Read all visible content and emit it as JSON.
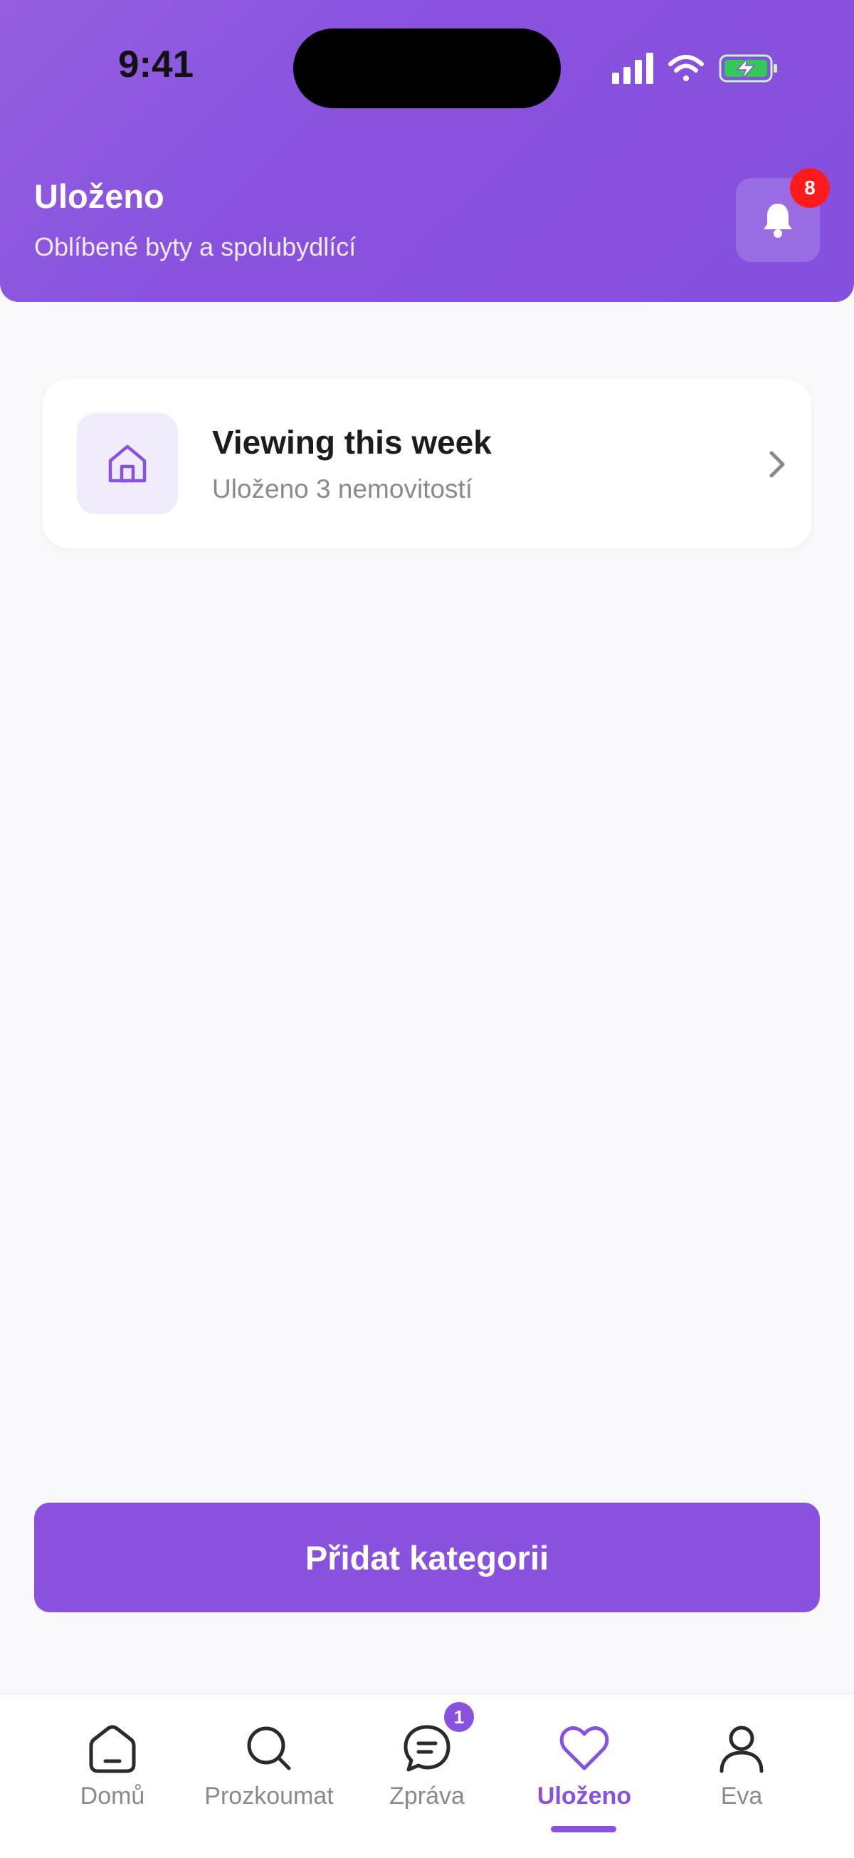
{
  "status_bar": {
    "time": "9:41"
  },
  "header": {
    "title": "Uloženo",
    "subtitle": "Oblíbené byty a spolubydlící",
    "notification_count": "8"
  },
  "categories": [
    {
      "title": "Viewing this week",
      "subtitle": "Uloženo 3 nemovitostí",
      "icon": "home-icon"
    }
  ],
  "add_button_label": "Přidat kategorii",
  "tabbar": {
    "items": [
      {
        "label": "Domů",
        "icon": "home-outline-icon"
      },
      {
        "label": "Prozkoumat",
        "icon": "search-icon"
      },
      {
        "label": "Zpráva",
        "icon": "chat-icon",
        "badge": "1"
      },
      {
        "label": "Uloženo",
        "icon": "heart-icon",
        "active": true
      },
      {
        "label": "Eva",
        "icon": "user-icon"
      }
    ]
  },
  "colors": {
    "accent": "#8852df",
    "badge_red": "#ff1b1b",
    "background": "#f9f8fb"
  }
}
